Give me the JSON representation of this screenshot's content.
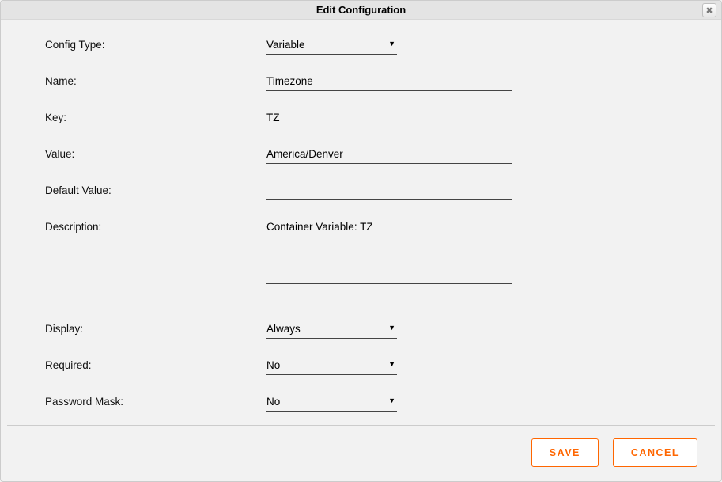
{
  "dialog": {
    "title": "Edit Configuration"
  },
  "form": {
    "config_type": {
      "label": "Config Type:",
      "value": "Variable"
    },
    "name": {
      "label": "Name:",
      "value": "Timezone"
    },
    "key": {
      "label": "Key:",
      "value": "TZ"
    },
    "value": {
      "label": "Value:",
      "value": "America/Denver"
    },
    "default": {
      "label": "Default Value:",
      "value": ""
    },
    "description": {
      "label": "Description:",
      "value": "Container Variable: TZ"
    },
    "display": {
      "label": "Display:",
      "value": "Always"
    },
    "required": {
      "label": "Required:",
      "value": "No"
    },
    "password_mask": {
      "label": "Password Mask:",
      "value": "No"
    }
  },
  "buttons": {
    "save": "SAVE",
    "cancel": "CANCEL"
  }
}
